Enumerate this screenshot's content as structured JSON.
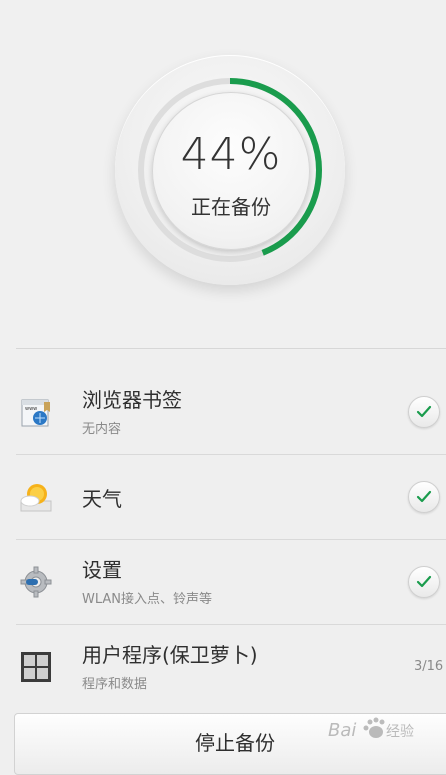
{
  "progress": {
    "percent_label": "44%",
    "value": 0.44,
    "status_text": "正在备份",
    "accent_color": "#1a9c4d"
  },
  "items": [
    {
      "title": "浏览器书签",
      "subtitle": "无内容",
      "icon": "browser-bookmarks-icon",
      "checked": true
    },
    {
      "title": "天气",
      "subtitle": "",
      "icon": "weather-sun-cloud-icon",
      "checked": true
    },
    {
      "title": "设置",
      "subtitle": "WLAN接入点、铃声等",
      "icon": "settings-gear-icon",
      "checked": true
    },
    {
      "title": "用户程序(保卫萝卜)",
      "subtitle": "程序和数据",
      "icon": "app-grid-icon",
      "checked": false,
      "count": "3/16"
    }
  ],
  "stop_button_label": "停止备份",
  "watermark": "Bai 经验"
}
